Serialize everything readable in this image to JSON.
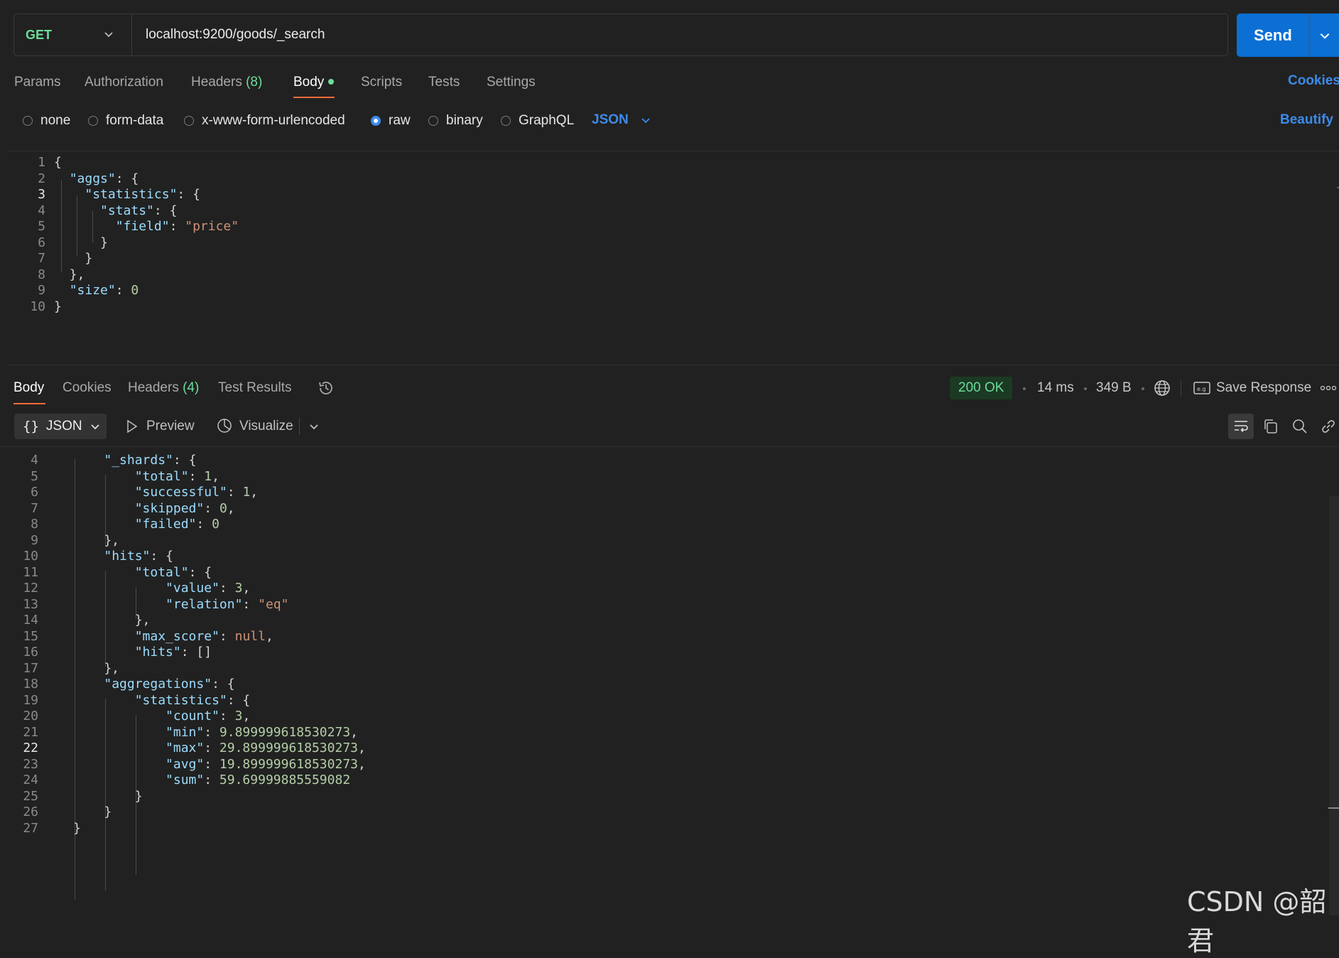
{
  "request": {
    "method": "GET",
    "url": "localhost:9200/goods/_search",
    "send_label": "Send"
  },
  "request_tabs": {
    "params": "Params",
    "authorization": "Authorization",
    "headers": "Headers",
    "headers_count": "(8)",
    "body": "Body",
    "scripts": "Scripts",
    "tests": "Tests",
    "settings": "Settings",
    "cookies": "Cookies"
  },
  "body_types": {
    "none": "none",
    "form_data": "form-data",
    "urlencoded": "x-www-form-urlencoded",
    "raw": "raw",
    "binary": "binary",
    "graphql": "GraphQL",
    "selected": "raw",
    "language": "JSON",
    "beautify": "Beautify"
  },
  "request_body": [
    {
      "n": "1",
      "t": [
        [
          "p",
          "{"
        ]
      ]
    },
    {
      "n": "2",
      "t": [
        [
          "p",
          "  "
        ],
        [
          "k",
          "\"aggs\""
        ],
        [
          "p",
          ": {"
        ]
      ]
    },
    {
      "n": "3",
      "t": [
        [
          "p",
          "    "
        ],
        [
          "k",
          "\"statistics\""
        ],
        [
          "p",
          ": {"
        ]
      ]
    },
    {
      "n": "4",
      "t": [
        [
          "p",
          "      "
        ],
        [
          "k",
          "\"stats\""
        ],
        [
          "p",
          ": {"
        ]
      ]
    },
    {
      "n": "5",
      "t": [
        [
          "p",
          "        "
        ],
        [
          "k",
          "\"field\""
        ],
        [
          "p",
          ": "
        ],
        [
          "s",
          "\"price\""
        ]
      ]
    },
    {
      "n": "6",
      "t": [
        [
          "p",
          "      }"
        ]
      ]
    },
    {
      "n": "7",
      "t": [
        [
          "p",
          "    }"
        ]
      ]
    },
    {
      "n": "8",
      "t": [
        [
          "p",
          "  },"
        ]
      ]
    },
    {
      "n": "9",
      "t": [
        [
          "p",
          "  "
        ],
        [
          "k",
          "\"size\""
        ],
        [
          "p",
          ": "
        ],
        [
          "n",
          "0"
        ]
      ]
    },
    {
      "n": "10",
      "t": [
        [
          "p",
          "}"
        ]
      ]
    }
  ],
  "response_tabs": {
    "body": "Body",
    "cookies": "Cookies",
    "headers": "Headers",
    "headers_count": "(4)",
    "test_results": "Test Results"
  },
  "response_meta": {
    "status": "200 OK",
    "time": "14 ms",
    "size": "349 B",
    "save_response": "Save Response"
  },
  "response_toolbar": {
    "format": "JSON",
    "preview": "Preview",
    "visualize": "Visualize"
  },
  "response_body": [
    {
      "n": "4",
      "t": [
        [
          "p",
          "    "
        ],
        [
          "k",
          "\"_shards\""
        ],
        [
          "p",
          ": {"
        ]
      ]
    },
    {
      "n": "5",
      "t": [
        [
          "p",
          "        "
        ],
        [
          "k",
          "\"total\""
        ],
        [
          "p",
          ": "
        ],
        [
          "n",
          "1"
        ],
        [
          "p",
          ","
        ]
      ]
    },
    {
      "n": "6",
      "t": [
        [
          "p",
          "        "
        ],
        [
          "k",
          "\"successful\""
        ],
        [
          "p",
          ": "
        ],
        [
          "n",
          "1"
        ],
        [
          "p",
          ","
        ]
      ]
    },
    {
      "n": "7",
      "t": [
        [
          "p",
          "        "
        ],
        [
          "k",
          "\"skipped\""
        ],
        [
          "p",
          ": "
        ],
        [
          "n",
          "0"
        ],
        [
          "p",
          ","
        ]
      ]
    },
    {
      "n": "8",
      "t": [
        [
          "p",
          "        "
        ],
        [
          "k",
          "\"failed\""
        ],
        [
          "p",
          ": "
        ],
        [
          "n",
          "0"
        ]
      ]
    },
    {
      "n": "9",
      "t": [
        [
          "p",
          "    },"
        ]
      ]
    },
    {
      "n": "10",
      "t": [
        [
          "p",
          "    "
        ],
        [
          "k",
          "\"hits\""
        ],
        [
          "p",
          ": {"
        ]
      ]
    },
    {
      "n": "11",
      "t": [
        [
          "p",
          "        "
        ],
        [
          "k",
          "\"total\""
        ],
        [
          "p",
          ": {"
        ]
      ]
    },
    {
      "n": "12",
      "t": [
        [
          "p",
          "            "
        ],
        [
          "k",
          "\"value\""
        ],
        [
          "p",
          ": "
        ],
        [
          "n",
          "3"
        ],
        [
          "p",
          ","
        ]
      ]
    },
    {
      "n": "13",
      "t": [
        [
          "p",
          "            "
        ],
        [
          "k",
          "\"relation\""
        ],
        [
          "p",
          ": "
        ],
        [
          "s",
          "\"eq\""
        ]
      ]
    },
    {
      "n": "14",
      "t": [
        [
          "p",
          "        },"
        ]
      ]
    },
    {
      "n": "15",
      "t": [
        [
          "p",
          "        "
        ],
        [
          "k",
          "\"max_score\""
        ],
        [
          "p",
          ": "
        ],
        [
          "s",
          "null"
        ],
        [
          "p",
          ","
        ]
      ]
    },
    {
      "n": "16",
      "t": [
        [
          "p",
          "        "
        ],
        [
          "k",
          "\"hits\""
        ],
        [
          "p",
          ": []"
        ]
      ]
    },
    {
      "n": "17",
      "t": [
        [
          "p",
          "    },"
        ]
      ]
    },
    {
      "n": "18",
      "t": [
        [
          "p",
          "    "
        ],
        [
          "k",
          "\"aggregations\""
        ],
        [
          "p",
          ": {"
        ]
      ]
    },
    {
      "n": "19",
      "t": [
        [
          "p",
          "        "
        ],
        [
          "k",
          "\"statistics\""
        ],
        [
          "p",
          ": {"
        ]
      ]
    },
    {
      "n": "20",
      "t": [
        [
          "p",
          "            "
        ],
        [
          "k",
          "\"count\""
        ],
        [
          "p",
          ": "
        ],
        [
          "n",
          "3"
        ],
        [
          "p",
          ","
        ]
      ]
    },
    {
      "n": "21",
      "t": [
        [
          "p",
          "            "
        ],
        [
          "k",
          "\"min\""
        ],
        [
          "p",
          ": "
        ],
        [
          "n",
          "9.899999618530273"
        ],
        [
          "p",
          ","
        ]
      ]
    },
    {
      "n": "22",
      "t": [
        [
          "p",
          "            "
        ],
        [
          "k",
          "\"max\""
        ],
        [
          "p",
          ": "
        ],
        [
          "n",
          "29.899999618530273"
        ],
        [
          "p",
          ","
        ]
      ]
    },
    {
      "n": "23",
      "t": [
        [
          "p",
          "            "
        ],
        [
          "k",
          "\"avg\""
        ],
        [
          "p",
          ": "
        ],
        [
          "n",
          "19.899999618530273"
        ],
        [
          "p",
          ","
        ]
      ]
    },
    {
      "n": "24",
      "t": [
        [
          "p",
          "            "
        ],
        [
          "k",
          "\"sum\""
        ],
        [
          "p",
          ": "
        ],
        [
          "n",
          "59.69999885559082"
        ]
      ]
    },
    {
      "n": "25",
      "t": [
        [
          "p",
          "        }"
        ]
      ]
    },
    {
      "n": "26",
      "t": [
        [
          "p",
          "    }"
        ]
      ]
    },
    {
      "n": "27",
      "t": [
        [
          "p",
          "}"
        ]
      ]
    }
  ],
  "watermark": "CSDN @韶君",
  "colors": {
    "accent": "#0b6fd4",
    "link": "#3d8be8",
    "method_green": "#6bdd9a",
    "active_tab": "#f26b3a",
    "json_key": "#9cdcfe",
    "json_string": "#ce9178",
    "json_number": "#b5cea8"
  },
  "icons": [
    "chevron-down-icon",
    "history-icon",
    "globe-icon",
    "save-icon",
    "more-icon",
    "play-icon",
    "visualize-icon",
    "wrap-icon",
    "copy-icon",
    "search-icon",
    "link-icon",
    "braces-icon"
  ]
}
